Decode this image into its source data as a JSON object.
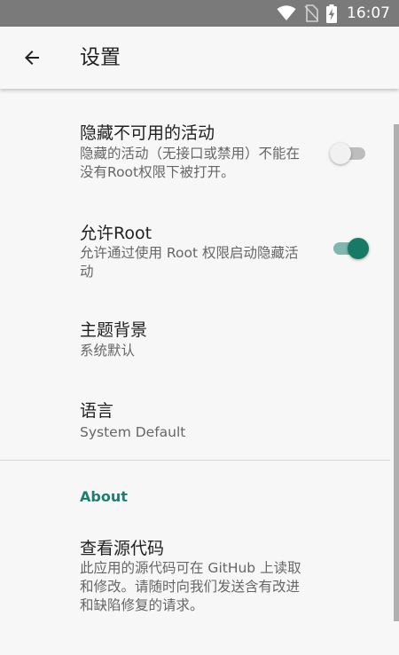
{
  "status_bar": {
    "time": "16:07",
    "icons": [
      "wifi-icon",
      "no-sim-icon",
      "battery-charging-icon"
    ]
  },
  "toolbar": {
    "back_icon": "arrow-back-icon",
    "title": "设置"
  },
  "preferences": {
    "hide_unavailable": {
      "title": "隐藏不可用的活动",
      "summary": "隐藏的活动（无接口或禁用）不能在没有Root权限下被打开。",
      "enabled": false
    },
    "allow_root": {
      "title": "允许Root",
      "summary": "允许通过使用 Root 权限启动隐藏活动",
      "enabled": true
    },
    "theme": {
      "title": "主题背景",
      "summary": "系统默认"
    },
    "language": {
      "title": "语言",
      "summary": "System Default"
    }
  },
  "about": {
    "header": "About",
    "source_code": {
      "title": "查看源代码",
      "summary": "此应用的源代码可在 GitHub 上读取和修改。请随时向我们发送含有改进和缺陷修复的请求。"
    }
  },
  "colors": {
    "accent": "#167a67",
    "accent_track": "#7fb8ae",
    "status_bar": "#7a7a7a"
  }
}
